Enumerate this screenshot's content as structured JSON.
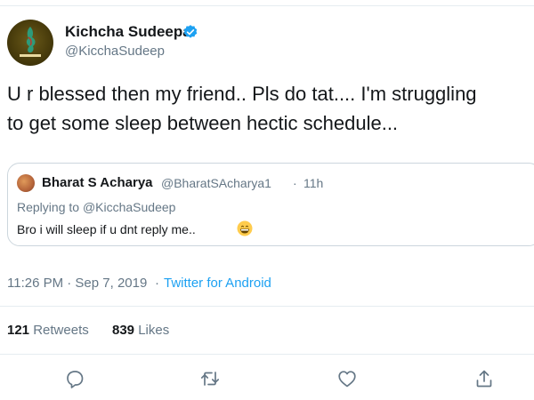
{
  "author": {
    "display_name": "Kichcha Sudeepa",
    "handle": "@KicchaSudeep",
    "verified_icon": "verified-badge-icon",
    "avatar_text": "KICHCHA"
  },
  "tweet": {
    "text": "U r blessed then my friend.. Pls do tat.... I'm struggling\nto get some sleep between hectic schedule..."
  },
  "quoted_tweet": {
    "author_name": "Bharat S Acharya",
    "author_handle": "@BharatSAcharya1",
    "separator": "·",
    "time": "11h",
    "replying_prefix": "Replying to ",
    "replying_to": "@KicchaSudeep",
    "text": "Bro i will sleep if u dnt reply me..",
    "emoji_icon": "grinning-face-emoji"
  },
  "meta": {
    "time": "11:26 PM · Sep 7, 2019",
    "separator": "·",
    "source": "Twitter for Android"
  },
  "stats": {
    "retweets_count": "121",
    "retweets_label": "Retweets",
    "likes_count": "839",
    "likes_label": "Likes"
  },
  "actions": [
    "reply-icon",
    "retweet-icon",
    "like-icon",
    "share-icon"
  ],
  "colors": {
    "accent": "#1da1f2",
    "secondary_text": "#657786",
    "primary_text": "#14171a",
    "border": "#e6ecf0"
  }
}
